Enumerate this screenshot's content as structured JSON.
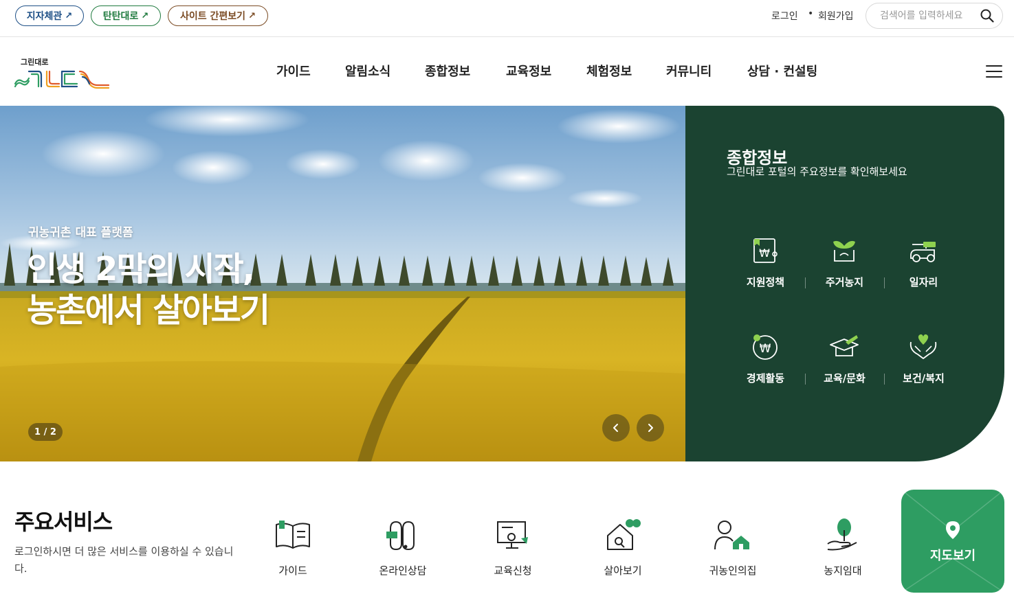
{
  "top_links": [
    {
      "label": "지자체관",
      "arrow": "↗"
    },
    {
      "label": "탄탄대로",
      "arrow": "↗"
    },
    {
      "label": "사이트 간편보기",
      "arrow": "↗"
    }
  ],
  "util": {
    "login": "로그인",
    "dot": "•",
    "join": "회원가입"
  },
  "search": {
    "placeholder": "검색어를 입력하세요",
    "icon": "search-icon"
  },
  "logo": {
    "small_text": "그린대로",
    "colors": [
      "#2e9d62",
      "#1d4f86",
      "#e05a2a",
      "#f0a020"
    ]
  },
  "nav": [
    "가이드",
    "알림소식",
    "종합정보",
    "교육정보",
    "체험정보",
    "커뮤니티",
    "상담 · 컨설팅"
  ],
  "hero": {
    "subtitle": "귀농귀촌 대표 플랫폼",
    "title_line1": "인생 2막의 시작,",
    "title_line2": "농촌에서 살아보기",
    "counter": "1 / 2",
    "prev_icon": "chevron-left-icon",
    "next_icon": "chevron-right-icon"
  },
  "panel": {
    "title": "종합정보",
    "desc": "그린대로 포털의 주요정보를 확인해보세요",
    "items": [
      {
        "label": "지원정책",
        "icon": "support-policy-icon"
      },
      {
        "label": "주거농지",
        "icon": "housing-farmland-icon"
      },
      {
        "label": "일자리",
        "icon": "jobs-icon"
      },
      {
        "label": "경제활동",
        "icon": "economy-icon"
      },
      {
        "label": "교육/문화",
        "icon": "education-culture-icon"
      },
      {
        "label": "보건/복지",
        "icon": "health-welfare-icon"
      }
    ],
    "bg_color": "#1b4331",
    "accent": "#8fd14f"
  },
  "services": {
    "title": "주요서비스",
    "desc": "로그인하시면 더 많은 서비스를 이용하실 수 있습니다.",
    "items": [
      {
        "label": "가이드",
        "icon": "guide-book-icon"
      },
      {
        "label": "온라인상담",
        "icon": "online-consult-icon"
      },
      {
        "label": "교육신청",
        "icon": "education-apply-icon"
      },
      {
        "label": "살아보기",
        "icon": "trial-living-icon"
      },
      {
        "label": "귀농인의집",
        "icon": "farmer-house-icon"
      },
      {
        "label": "농지임대",
        "icon": "farmland-lease-icon"
      }
    ],
    "map_label": "지도보기",
    "map_icon": "map-pin-icon",
    "accent": "#2e9d62"
  }
}
